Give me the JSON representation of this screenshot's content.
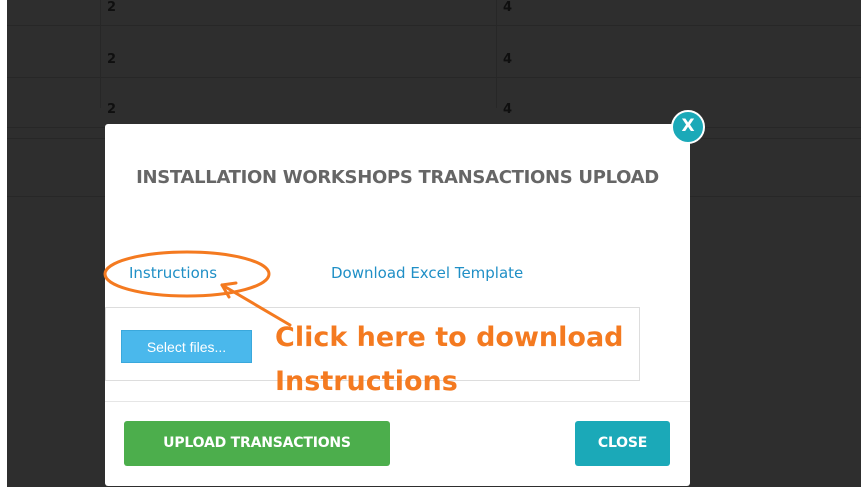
{
  "background_table": {
    "rows": [
      {
        "col1": "2",
        "col2": "4"
      },
      {
        "col1": "2",
        "col2": "4"
      },
      {
        "col1": "2",
        "col2": "4"
      }
    ]
  },
  "modal": {
    "title": "INSTALLATION WORKSHOPS TRANSACTIONS UPLOAD",
    "instructions_link": "Instructions",
    "download_template_link": "Download Excel Template",
    "select_files_button": "Select files...",
    "upload_button": "UPLOAD TRANSACTIONS",
    "close_button": "CLOSE",
    "close_x": "X"
  },
  "annotation": {
    "text_line1": "Click here to download",
    "text_line2": "Instructions",
    "color": "#f47a20"
  },
  "colors": {
    "link": "#1f8fc6",
    "upload_button": "#4cae4c",
    "close_button": "#1ba9b8",
    "select_files": "#4ab8ec"
  },
  "icons": [
    "close-x-icon"
  ]
}
